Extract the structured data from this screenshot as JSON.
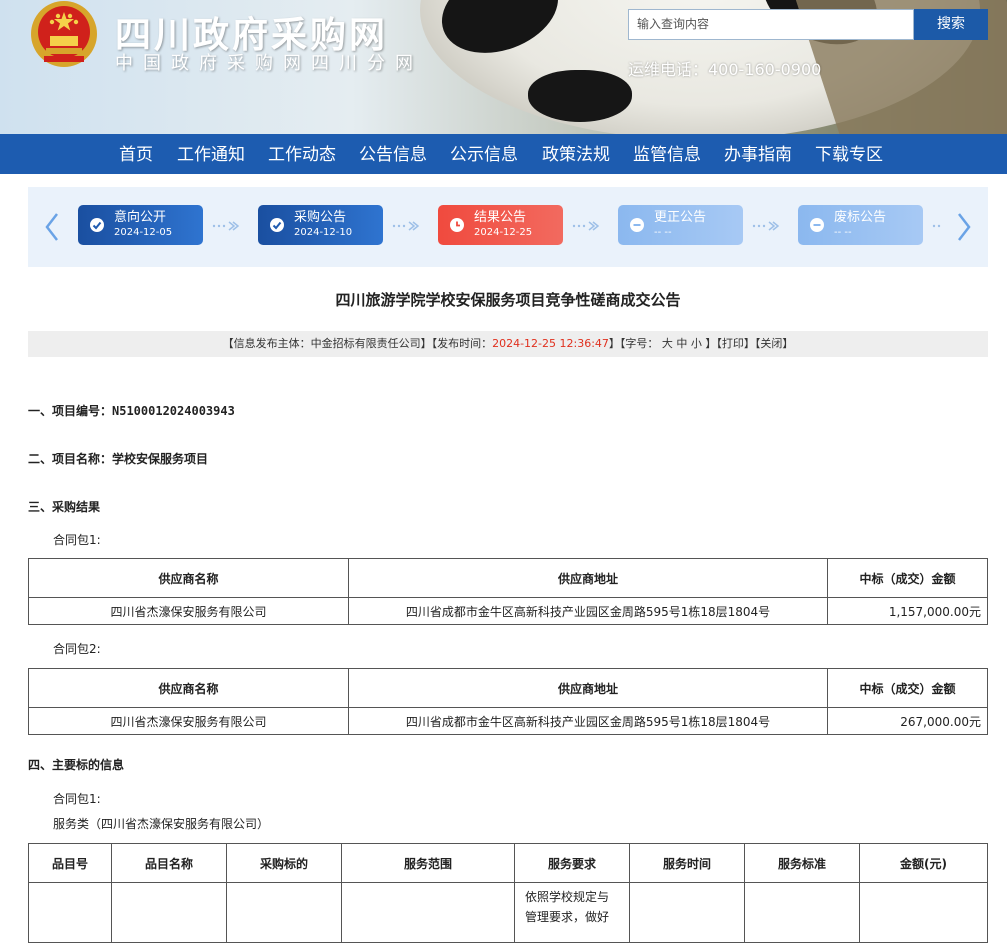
{
  "header": {
    "site_title": "四川政府采购网",
    "site_subtitle": "中国政府采购网四川分网",
    "search_placeholder": "输入查询内容",
    "search_button": "搜索",
    "hotline": "运维电话：400-160-0900"
  },
  "nav": [
    "首页",
    "工作通知",
    "工作动态",
    "公告信息",
    "公示信息",
    "政策法规",
    "监管信息",
    "办事指南",
    "下载专区"
  ],
  "progress": [
    {
      "name": "意向公开",
      "date": "2024-12-05",
      "status": "done"
    },
    {
      "name": "采购公告",
      "date": "2024-12-10",
      "status": "done"
    },
    {
      "name": "结果公告",
      "date": "2024-12-25",
      "status": "current"
    },
    {
      "name": "更正公告",
      "date": "-- --",
      "status": "none"
    },
    {
      "name": "废标公告",
      "date": "-- --",
      "status": "none"
    }
  ],
  "doc": {
    "title": "四川旅游学院学校安保服务项目竞争性磋商成交公告",
    "info_prefix": "【信息发布主体：中金招标有限责任公司】【发布时间：",
    "info_time": "2024-12-25 12:36:47",
    "info_suffix": "】【字号： 大 中 小 】【打印】【关闭】"
  },
  "sections": {
    "s1": "一、项目编号：N5100012024003943",
    "s2": "二、项目名称：学校安保服务项目",
    "s3": "三、采购结果",
    "s4": "四、主要标的信息"
  },
  "results": {
    "pkg1_label": "合同包1:",
    "pkg2_label": "合同包2:",
    "headers": [
      "供应商名称",
      "供应商地址",
      "中标（成交）金额"
    ],
    "pkg1_row": [
      "四川省杰濠保安服务有限公司",
      "四川省成都市金牛区高新科技产业园区金周路595号1栋18层1804号",
      "1,157,000.00元"
    ],
    "pkg2_row": [
      "四川省杰濠保安服务有限公司",
      "四川省成都市金牛区高新科技产业园区金周路595号1栋18层1804号",
      "267,000.00元"
    ]
  },
  "main_info": {
    "pkg_label": "合同包1:",
    "category": "服务类（四川省杰濠保安服务有限公司）",
    "headers": [
      "品目号",
      "品目名称",
      "采购标的",
      "服务范围",
      "服务要求",
      "服务时间",
      "服务标准",
      "金额(元)"
    ],
    "requirement_partial": "依照学校规定与管理要求，做好"
  }
}
